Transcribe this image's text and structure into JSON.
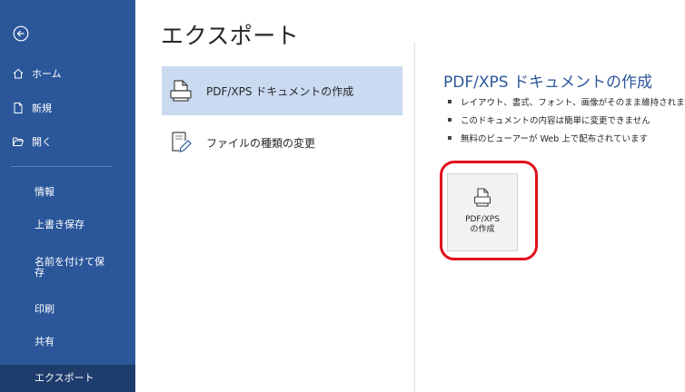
{
  "page": {
    "title": "エクスポート"
  },
  "sidebar": {
    "items": [
      {
        "label": "ホーム",
        "icon": "home-icon"
      },
      {
        "label": "新規",
        "icon": "new-document-icon"
      },
      {
        "label": "開く",
        "icon": "open-folder-icon"
      },
      {
        "label": "情報"
      },
      {
        "label": "上書き保存"
      },
      {
        "label": "名前を付けて保存"
      },
      {
        "label": "印刷"
      },
      {
        "label": "共有"
      },
      {
        "label": "エクスポート",
        "selected": true
      }
    ]
  },
  "options": [
    {
      "label": "PDF/XPS ドキュメントの作成",
      "icon": "pdf-document-icon",
      "selected": true
    },
    {
      "label": "ファイルの種類の変更",
      "icon": "change-file-type-icon"
    }
  ],
  "detail": {
    "title": "PDF/XPS ドキュメントの作成",
    "bullets": [
      "レイアウト、書式、フォント、画像がそのまま維持されま",
      "このドキュメントの内容は簡単に変更できません",
      "無料のビューアーが Web 上で配布されています"
    ],
    "button": {
      "line1": "PDF/XPS",
      "line2": "の作成"
    }
  },
  "colors": {
    "sidebar": "#2b579a",
    "selected_option": "#c9daf1",
    "highlight": "#e0101a"
  }
}
